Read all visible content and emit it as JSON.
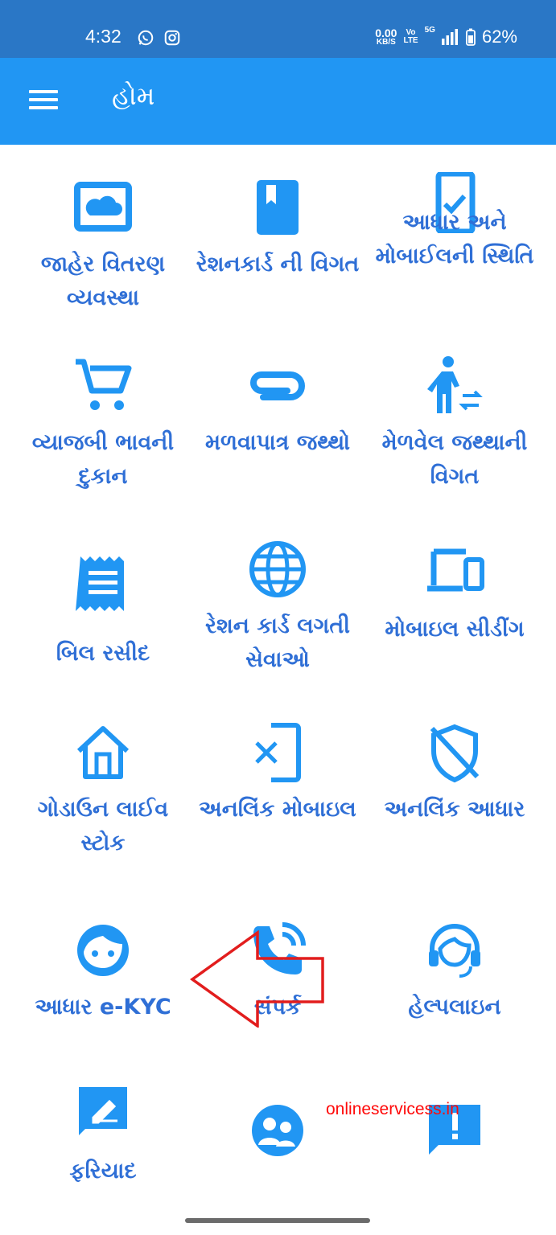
{
  "status_bar": {
    "time": "4:32",
    "net_speed_top": "0.00",
    "net_speed_unit": "KB/S",
    "volte_top": "Vo",
    "volte_bottom": "LTE",
    "network": "5G",
    "battery": "62%",
    "icons": [
      "whatsapp-icon",
      "instagram-icon",
      "signal-icon",
      "battery-icon"
    ]
  },
  "appbar": {
    "title": "હોમ",
    "menu_icon": "hamburger-menu-icon"
  },
  "tiles": [
    {
      "label": "જાહેર વિતરણ વ્યવસ્થા",
      "icon": "cloud-icon"
    },
    {
      "label": "રેશનકાર્ડ ની વિગત",
      "icon": "book-icon"
    },
    {
      "label": "આધાર અને મોબાઈલની સ્થિતિ",
      "icon": "phone-check-icon"
    },
    {
      "label": "વ્યાજબી ભાવની દુકાન",
      "icon": "cart-icon"
    },
    {
      "label": "મળવાપાત્ર જથ્થો",
      "icon": "paperclip-icon"
    },
    {
      "label": "મેળવેલ જથ્થાની વિગત",
      "icon": "walking-person-icon"
    },
    {
      "label": "બિલ રસીદ",
      "icon": "receipt-icon"
    },
    {
      "label": "રેશન કાર્ડ લગતી સેવાઓ",
      "icon": "globe-icon"
    },
    {
      "label": "મોબાઇલ સીડીંગ",
      "icon": "devices-icon"
    },
    {
      "label": "ગોડાઉન લાઈવ સ્ટોક",
      "icon": "home-icon"
    },
    {
      "label": "અનલિંક મોબાઇલ",
      "icon": "phone-off-icon"
    },
    {
      "label": "અનલિંક આધાર",
      "icon": "shield-off-icon"
    },
    {
      "label": "આધાર e-KYC",
      "icon": "face-icon"
    },
    {
      "label": "સંપર્ક",
      "icon": "phone-call-icon"
    },
    {
      "label": "હેલ્પલાઇન",
      "icon": "headset-icon"
    },
    {
      "label": "ફરિયાદ",
      "icon": "feedback-icon"
    },
    {
      "label": "",
      "icon": "group-icon"
    },
    {
      "label": "",
      "icon": "alert-message-icon"
    }
  ],
  "watermark": "onlineservicess.in",
  "colors": {
    "status_bar": "#2a77c6",
    "appbar": "#2196f3",
    "icon": "#2196f3",
    "label": "#2f6fd6",
    "arrow": "#e21d1d",
    "watermark": "#ff0a0a"
  }
}
